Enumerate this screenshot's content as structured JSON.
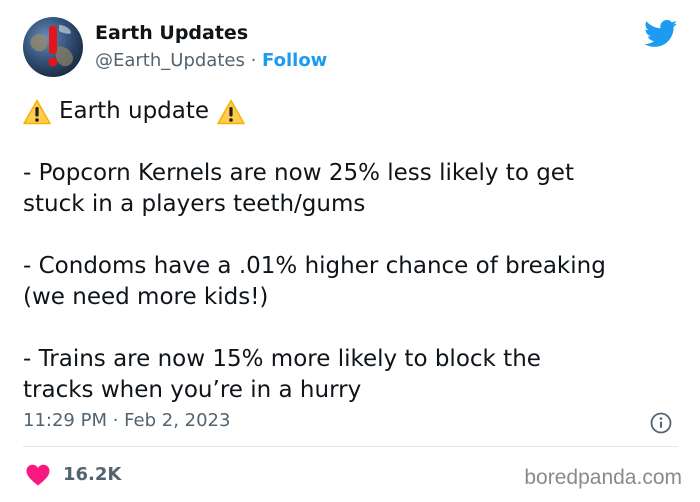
{
  "author": {
    "name": "Earth Updates",
    "handle": "@Earth_Updates",
    "separator": "·",
    "follow_label": "Follow",
    "avatar_icon": "earth-warning-avatar"
  },
  "tweet": {
    "heading": "Earth update",
    "heading_icon": "warning-emoji",
    "items": [
      {
        "line1": "- Popcorn Kernels are now 25% less likely to get",
        "line2": "stuck in a players teeth/gums"
      },
      {
        "line1": "- Condoms have a .01% higher chance of breaking",
        "line2": "(we need more kids!)"
      },
      {
        "line1": "- Trains are now 15% more likely to block the",
        "line2": "tracks when you’re in a hurry"
      }
    ],
    "timestamp": "11:29 PM · Feb 2, 2023"
  },
  "engagement": {
    "likes": "16.2K",
    "heart_color": "#f91880"
  },
  "watermark": "boredpanda.com",
  "colors": {
    "twitter_blue": "#1d9bf0",
    "secondary_text": "#536471",
    "warning_yellow": "#ffcc4d"
  }
}
